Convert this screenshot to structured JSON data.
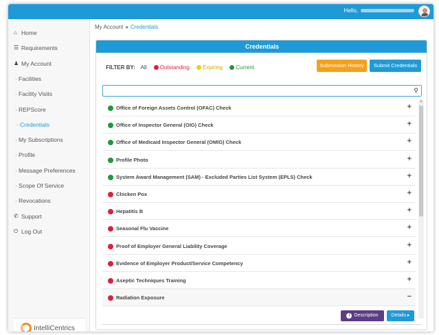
{
  "header": {
    "greeting": "Hello,"
  },
  "sidebar": {
    "items": [
      {
        "icon": "home-icon",
        "glyph": "⌂",
        "label": "Home",
        "sub": false,
        "active": false
      },
      {
        "icon": "list-icon",
        "glyph": "☰",
        "label": "Requirements",
        "sub": false,
        "active": false
      },
      {
        "icon": "user-icon",
        "glyph": "♟",
        "label": "My Account",
        "sub": false,
        "active": false
      },
      {
        "label": "Facilities",
        "sub": true,
        "active": false
      },
      {
        "label": "Facility Visits",
        "sub": true,
        "active": false
      },
      {
        "label": "REPScore",
        "sub": true,
        "active": false
      },
      {
        "label": "Credentials",
        "sub": true,
        "active": true
      },
      {
        "label": "My Subscriptions",
        "sub": true,
        "active": false
      },
      {
        "label": "Profile",
        "sub": true,
        "active": false
      },
      {
        "label": "Message Preferences",
        "sub": true,
        "active": false
      },
      {
        "label": "Scope Of Service",
        "sub": true,
        "active": false
      },
      {
        "label": "Revocations",
        "sub": true,
        "active": false
      },
      {
        "icon": "phone-icon",
        "glyph": "✆",
        "label": "Support",
        "sub": false,
        "active": false
      },
      {
        "icon": "power-icon",
        "glyph": "⏻",
        "label": "Log Out",
        "sub": false,
        "active": false
      }
    ],
    "logo_text": "IntelliCentrics"
  },
  "breadcrumb": {
    "parent": "My Account",
    "separator": "»",
    "current": "Credentials"
  },
  "panel": {
    "title": "Credentials",
    "filter_label": "FILTER BY:",
    "filter_all": "All",
    "filters": [
      {
        "label": "Outstanding",
        "color": "#e01e3c"
      },
      {
        "label": "Expiring",
        "color": "#f5d000"
      },
      {
        "label": "Current",
        "color": "#1e9a3a"
      }
    ],
    "history_button": "Submission History",
    "submit_button": "Submit Credentials",
    "search_value": ""
  },
  "credentials": [
    {
      "name": "Office of Foreign Assets Control (OFAC) Check",
      "status": "current",
      "toggle": "+"
    },
    {
      "name": "Office of Inspector General (OIG) Check",
      "status": "current",
      "toggle": "+"
    },
    {
      "name": "Office of Medicaid Inspector General (OMIG) Check",
      "status": "current",
      "toggle": "+"
    },
    {
      "name": "Profile Photo",
      "status": "current",
      "toggle": "+"
    },
    {
      "name": "System Award Management (SAM) - Excluded Parties List System (EPLS) Check",
      "status": "current",
      "toggle": "+"
    },
    {
      "name": "Chicken Pox",
      "status": "outstanding",
      "toggle": "+"
    },
    {
      "name": "Hepatitis B",
      "status": "outstanding",
      "toggle": "+"
    },
    {
      "name": "Seasonal Flu Vaccine",
      "status": "outstanding",
      "toggle": "+"
    },
    {
      "name": "Proof of Employer General Liability Coverage",
      "status": "outstanding",
      "toggle": "+"
    },
    {
      "name": "Evidence of Employer Product/Service Competency",
      "status": "outstanding",
      "toggle": "+"
    },
    {
      "name": "Aseptic Techniques Training",
      "status": "outstanding",
      "toggle": "+"
    },
    {
      "name": "Radiation Exposure",
      "status": "outstanding",
      "toggle": "−"
    }
  ],
  "status_colors": {
    "current": "#1e9a3a",
    "outstanding": "#e01e3c",
    "expiring": "#f5d000"
  },
  "expanded_actions": {
    "description": "Description",
    "details": "Details ▸"
  }
}
